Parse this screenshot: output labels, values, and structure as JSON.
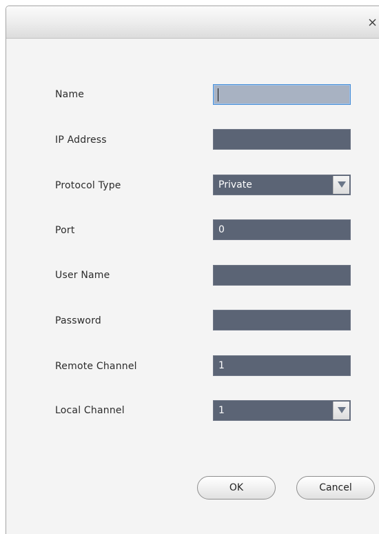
{
  "dialog": {
    "close_glyph": "×",
    "close_icon": "close-icon"
  },
  "form": {
    "name": {
      "label": "Name",
      "value": ""
    },
    "ip_address": {
      "label": "IP Address",
      "value": ""
    },
    "protocol_type": {
      "label": "Protocol Type",
      "value": "Private",
      "options": [
        "Private"
      ]
    },
    "port": {
      "label": "Port",
      "value": "0"
    },
    "user_name": {
      "label": "User Name",
      "value": ""
    },
    "password": {
      "label": "Password",
      "value": ""
    },
    "remote_channel": {
      "label": "Remote Channel",
      "value": "1"
    },
    "local_channel": {
      "label": "Local Channel",
      "value": "1",
      "options": [
        "1"
      ]
    }
  },
  "buttons": {
    "ok_label": "OK",
    "cancel_label": "Cancel"
  },
  "colors": {
    "field_background": "#5b6475",
    "active_field_background": "#a8b2c2",
    "focus_border": "#4a8fd6",
    "dialog_background": "#f4f4f4"
  }
}
